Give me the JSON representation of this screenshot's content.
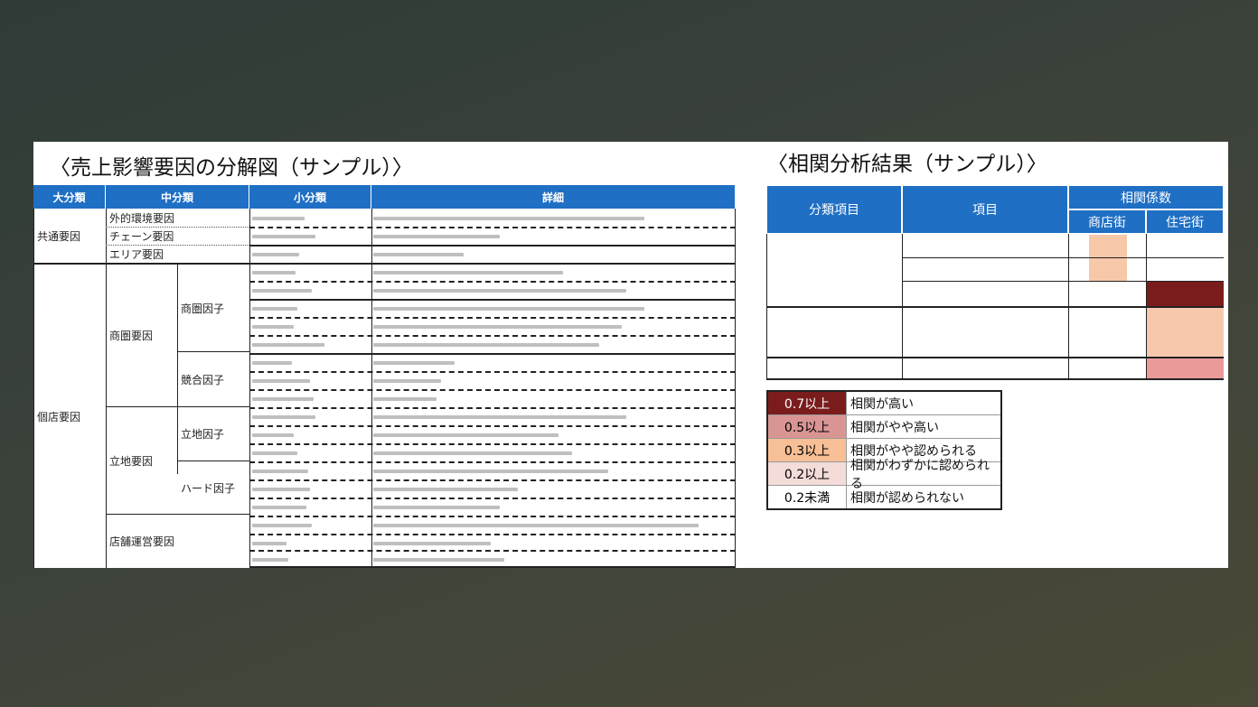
{
  "titles": {
    "left": "〈売上影響要因の分解図（サンプル）〉",
    "right": "〈相関分析結果（サンプル）〉"
  },
  "breakdown": {
    "headers": [
      "大分類",
      "中分類",
      "小分類",
      "詳細"
    ],
    "major": [
      "共通要因",
      "個店要因"
    ],
    "common_middle": [
      "外的環境要因",
      "チェーン要因",
      "エリア要因"
    ],
    "store_middle": [
      "商圏要因",
      "立地要因",
      "店舗運営要因"
    ],
    "store_sub": [
      "商圏因子",
      "競合因子",
      "立地因子",
      "ハード因子"
    ]
  },
  "correlation": {
    "headers": {
      "category": "分類項目",
      "item": "項目",
      "coef": "相関係数",
      "shopping": "商店街",
      "residential": "住宅街"
    },
    "colors": {
      "high": "#7b1c1c",
      "mid_high": "#d99594",
      "mid": "#f7bf95",
      "low": "#f4dcd9",
      "none": "#ffffff"
    }
  },
  "legend": [
    {
      "range": "0.7以上",
      "label": "相関が高い",
      "color": "#7b1c1c",
      "text_color": "#ffffff"
    },
    {
      "range": "0.5以上",
      "label": "相関がやや高い",
      "color": "#d99594",
      "text_color": "#222222"
    },
    {
      "range": "0.3以上",
      "label": "相関がやや認められる",
      "color": "#f7bf95",
      "text_color": "#222222"
    },
    {
      "range": "0.2以上",
      "label": "相関がわずかに認められる",
      "color": "#f4dcd9",
      "text_color": "#222222"
    },
    {
      "range": "0.2未満",
      "label": "相関が認められない",
      "color": "#ffffff",
      "text_color": "#222222"
    }
  ]
}
